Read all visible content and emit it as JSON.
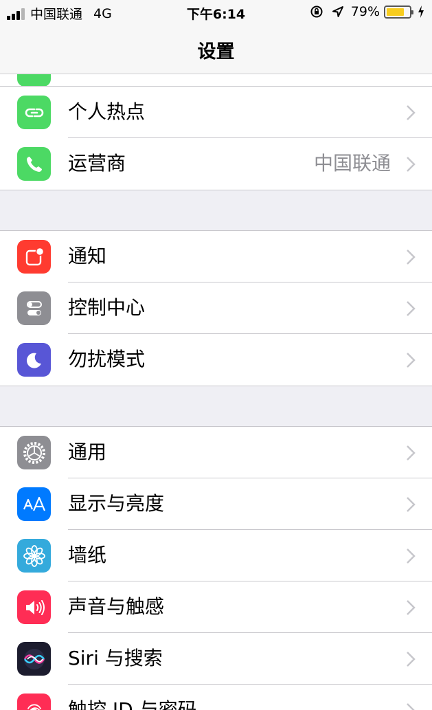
{
  "status_bar": {
    "carrier": "中国联通",
    "network": "4G",
    "time": "下午6:14",
    "battery_percent": "79%",
    "battery_level": 0.79
  },
  "nav": {
    "title": "设置"
  },
  "groups": [
    {
      "rows": [
        {
          "label": "个人热点",
          "icon": "personal-hotspot-icon",
          "color": "#4cd964"
        },
        {
          "label": "运营商",
          "icon": "carrier-phone-icon",
          "color": "#4cd964",
          "detail": "中国联通"
        }
      ]
    },
    {
      "rows": [
        {
          "label": "通知",
          "icon": "notifications-icon",
          "color": "#ff3b30"
        },
        {
          "label": "控制中心",
          "icon": "control-center-icon",
          "color": "#8e8e93"
        },
        {
          "label": "勿扰模式",
          "icon": "moon-icon",
          "color": "#5856d6"
        }
      ]
    },
    {
      "rows": [
        {
          "label": "通用",
          "icon": "gear-icon",
          "color": "#8e8e93"
        },
        {
          "label": "显示与亮度",
          "icon": "display-brightness-icon",
          "color": "#007aff"
        },
        {
          "label": "墙纸",
          "icon": "wallpaper-flower-icon",
          "color": "#34aadc"
        },
        {
          "label": "声音与触感",
          "icon": "sound-speaker-icon",
          "color": "#ff2d55"
        },
        {
          "label": "Siri 与搜索",
          "icon": "siri-icon",
          "color": "#1c1c2e"
        },
        {
          "label": "触控 ID 与密码",
          "icon": "fingerprint-icon",
          "color": "#ff2d55"
        }
      ]
    }
  ]
}
